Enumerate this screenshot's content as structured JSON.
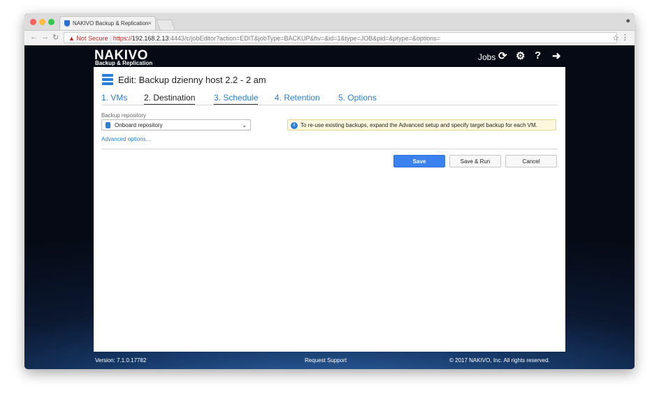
{
  "browser": {
    "tab_title": "NAKIVO Backup & Replication",
    "tab_close": "×",
    "not_secure": "Not Secure",
    "url_https": "https://",
    "url_host": "192.168.2.13",
    "url_rest": ":4443/c/jobEditor?action=EDIT&jobType=BACKUP&hv=&id=1&type=JOB&pid=&ptype=&options="
  },
  "header": {
    "logo_main": "NAKIVO",
    "logo_sub": "Backup & Replication",
    "jobs_label": "Jobs",
    "icons": [
      "refresh-icon",
      "gear-icon",
      "help-icon",
      "logout-icon"
    ]
  },
  "page": {
    "title": "Edit: Backup dzienny host 2.2 - 2 am",
    "tabs": [
      {
        "label": "1. VMs",
        "state": "link"
      },
      {
        "label": "2. Destination",
        "state": "done"
      },
      {
        "label": "3. Schedule",
        "state": "active"
      },
      {
        "label": "4. Retention",
        "state": "link"
      },
      {
        "label": "5. Options",
        "state": "link"
      }
    ],
    "repo_label": "Backup repository",
    "repo_value": "Onboard repository",
    "info_text": "To re-use existing backups, expand the Advanced setup and specify target backup for each VM.",
    "advanced_link": "Advanced options...",
    "buttons": {
      "save": "Save",
      "save_run": "Save & Run",
      "cancel": "Cancel"
    }
  },
  "footer": {
    "version": "Version: 7.1.0.17782",
    "support": "Request Support",
    "copyright": "© 2017 NAKIVO, Inc. All rights reserved."
  },
  "colors": {
    "accent": "#2b7fd6",
    "primary_button": "#3b82f0",
    "info_bg": "#fdf8dd"
  }
}
